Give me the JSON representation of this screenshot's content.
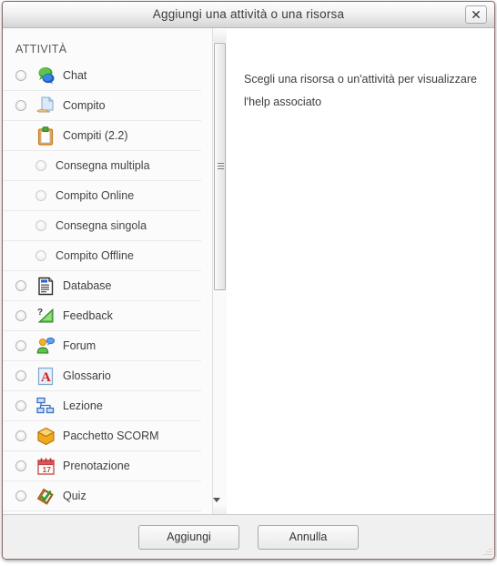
{
  "window": {
    "title": "Aggiungi una attività o una risorsa",
    "close_icon": "close-icon"
  },
  "list_pane": {
    "section_title": "ATTIVITÀ",
    "items": [
      {
        "label": "Chat",
        "icon": "chat-icon",
        "radio": true,
        "indent": false
      },
      {
        "label": "Compito",
        "icon": "assignment-icon",
        "radio": true,
        "indent": false
      },
      {
        "label": "Compiti (2.2)",
        "icon": "clipboard-icon",
        "radio": false,
        "indent": false
      },
      {
        "label": "Consegna multipla",
        "icon": "none",
        "radio": true,
        "indent": true
      },
      {
        "label": "Compito Online",
        "icon": "none",
        "radio": true,
        "indent": true
      },
      {
        "label": "Consegna singola",
        "icon": "none",
        "radio": true,
        "indent": true
      },
      {
        "label": "Compito Offline",
        "icon": "none",
        "radio": true,
        "indent": true
      },
      {
        "label": "Database",
        "icon": "database-icon",
        "radio": true,
        "indent": false
      },
      {
        "label": "Feedback",
        "icon": "feedback-icon",
        "radio": true,
        "indent": false
      },
      {
        "label": "Forum",
        "icon": "forum-icon",
        "radio": true,
        "indent": false
      },
      {
        "label": "Glossario",
        "icon": "glossary-icon",
        "radio": true,
        "indent": false
      },
      {
        "label": "Lezione",
        "icon": "lesson-icon",
        "radio": true,
        "indent": false
      },
      {
        "label": "Pacchetto SCORM",
        "icon": "scorm-icon",
        "radio": true,
        "indent": false
      },
      {
        "label": "Prenotazione",
        "icon": "calendar-icon",
        "radio": true,
        "indent": false
      },
      {
        "label": "Quiz",
        "icon": "quiz-icon",
        "radio": true,
        "indent": false
      }
    ]
  },
  "scrollbar": {
    "up_icon": "scroll-up-arrow-icon",
    "down_icon": "scroll-down-arrow-icon"
  },
  "help_pane": {
    "line1": "Scegli una risorsa o un'attività per visualizzare",
    "line2": "l'help associato"
  },
  "footer": {
    "add_label": "Aggiungi",
    "cancel_label": "Annulla"
  },
  "colors": {
    "window_border": "#8c6b6b",
    "titlebar_top": "#fdfdfd",
    "titlebar_bottom": "#d4d4d4",
    "footer_bg": "#f0f0f0",
    "list_bg": "#fbfbfb",
    "text": "#3d3d3d"
  }
}
